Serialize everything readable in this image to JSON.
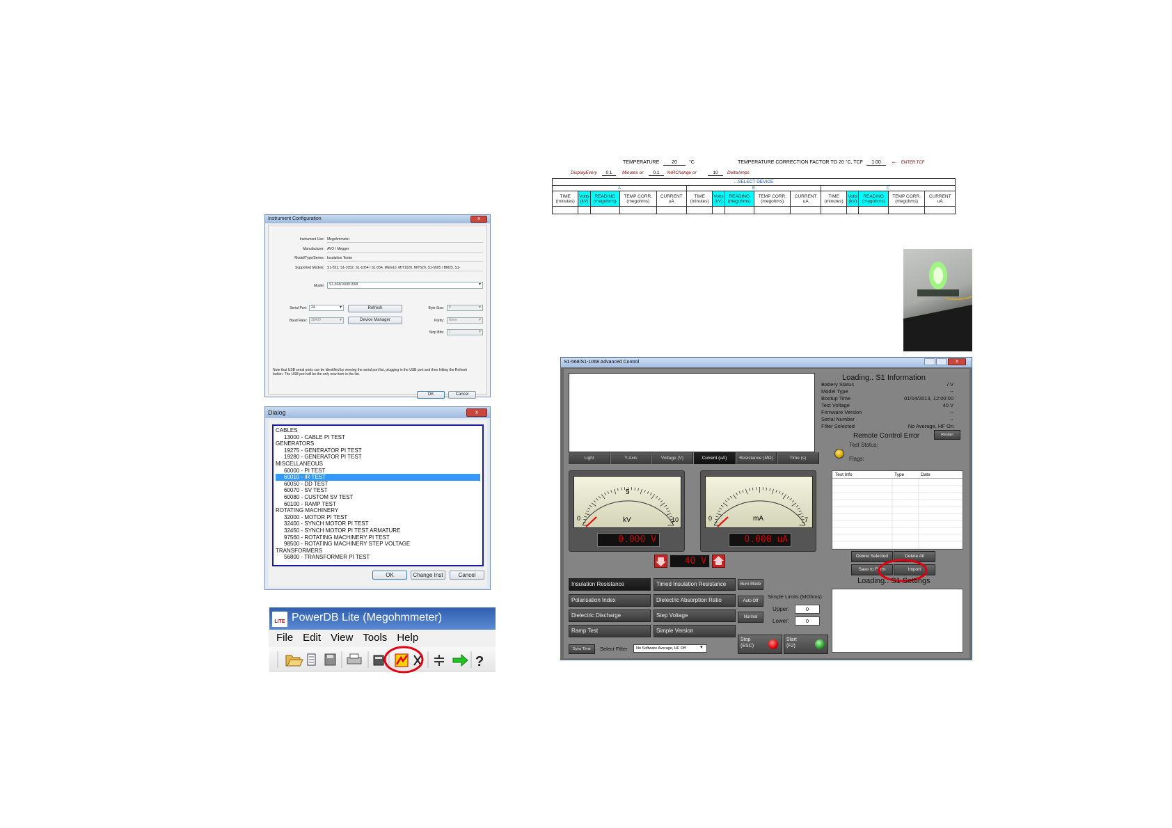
{
  "instrument_config": {
    "title": "Instrument Configuration",
    "close": "x",
    "fields": [
      {
        "label": "Instrument Use:",
        "value": "Megohmmeter"
      },
      {
        "label": "Manufacturer:",
        "value": "AVO / Megger"
      },
      {
        "label": "Model/Type/Series:",
        "value": "Insulation Tester"
      },
      {
        "label": "Supported Models:",
        "value": "S1-552, S1-1052, S1-1054 / S1-554, MEG10, MIT1020, MIT520, S1-5005 / BM25, S1-"
      }
    ],
    "model_label": "Model:",
    "model_value": "S1-568/1068/1568",
    "serial_port_label": "Serial Port:",
    "serial_port_value": "24",
    "baud_rate_label": "Baud Rate:",
    "baud_rate_value": "38400",
    "refresh": "Refresh",
    "device_manager": "Device Manager",
    "byte_size_label": "Byte Size:",
    "byte_size_value": "8",
    "parity_label": "Parity:",
    "parity_value": "None",
    "stop_bits_label": "Stop Bits:",
    "stop_bits_value": "1",
    "note": "Note that USB serial ports can be identified by viewing the serial port list, plugging in the USB port and then hitting the Refresh button. The USB port will be the only new item in the list.",
    "ok": "OK",
    "cancel": "Cancel"
  },
  "dialog": {
    "title": "Dialog",
    "close": "x",
    "items": [
      {
        "text": "CABLES",
        "indent": false
      },
      {
        "text": "13000 - CABLE PI TEST",
        "indent": true
      },
      {
        "text": "GENERATORS",
        "indent": false
      },
      {
        "text": "19275 - GENERATOR PI TEST",
        "indent": true
      },
      {
        "text": "19280 - GENERATOR PI TEST",
        "indent": true
      },
      {
        "text": "MISCELLANEOUS",
        "indent": false
      },
      {
        "text": "60000 - PI TEST",
        "indent": true
      },
      {
        "text": "60010 - IR TEST",
        "indent": true,
        "selected": true
      },
      {
        "text": "60050 - DD TEST",
        "indent": true
      },
      {
        "text": "60070 - SV TEST",
        "indent": true
      },
      {
        "text": "60080 - CUSTOM SV TEST",
        "indent": true
      },
      {
        "text": "60100 - RAMP TEST",
        "indent": true
      },
      {
        "text": "ROTATING MACHINERY",
        "indent": false
      },
      {
        "text": "32000 - MOTOR PI TEST",
        "indent": true
      },
      {
        "text": "32400 - SYNCH MOTOR PI TEST",
        "indent": true
      },
      {
        "text": "32450 - SYNCH MOTOR PI TEST ARMATURE",
        "indent": true
      },
      {
        "text": "97560 - ROTATING MACHINERY PI TEST",
        "indent": true
      },
      {
        "text": "98500 - ROTATING MACHINERY STEP VOLTAGE",
        "indent": true
      },
      {
        "text": "TRANSFORMERS",
        "indent": false
      },
      {
        "text": "56800 - TRANSFORMER PI TEST",
        "indent": true
      }
    ],
    "ok": "OK",
    "change_inst": "Change Inst",
    "cancel": "Cancel"
  },
  "powerdb": {
    "logo": "LITE",
    "title": "PowerDB Lite (Megohmmeter)",
    "menu": [
      "File",
      "Edit",
      "View",
      "Tools",
      "Help"
    ]
  },
  "form": {
    "temperature_label": "TEMPERATURE",
    "temperature_value": "20",
    "temperature_unit": "°C",
    "tcf_label": "TEMPERATURE CORRECTION FACTOR TO 20 °C, TCF",
    "tcf_value": "1.00",
    "enter_tcf": "ENTER TCF",
    "display_every_label": "DisplayEvery",
    "display_every_value": "0.1",
    "minutes_or": "Minutes or",
    "pct_value": "0.1",
    "pct_label": "%IRChange or",
    "delta_value": "10",
    "delta_label": "DeltaAmps",
    "select_device": "...SELECT DEVICE",
    "groups": [
      "A",
      "B",
      "C"
    ],
    "columns": [
      {
        "l1": "TIME",
        "l2": "(minutes)",
        "cyan": false
      },
      {
        "l1": "Volts",
        "l2": "(kV)",
        "cyan": true
      },
      {
        "l1": "READING",
        "l2": "(megohms)",
        "cyan": true
      },
      {
        "l1": "TEMP CORR.",
        "l2": "(megohms)",
        "cyan": false
      },
      {
        "l1": "CURRENT",
        "l2": "uA",
        "cyan": false
      }
    ]
  },
  "advanced": {
    "title": "S1-568/S1-1068 Advanced Control",
    "tabs": [
      "Light",
      "Y-Axis",
      "Voltage (V)",
      "Current (uA)",
      "Resistance (MΩ)",
      "Time (s)"
    ],
    "active_tab": 3,
    "info_title": "Loading.. S1 Information",
    "info": [
      {
        "label": "Battery Status",
        "value": "/ V"
      },
      {
        "label": "Model Type",
        "value": "--"
      },
      {
        "label": "Bootup Time",
        "value": "01/04/2013, 12:00:00"
      },
      {
        "label": "Test Voltage",
        "value": "40 V"
      },
      {
        "label": "Firmware Version",
        "value": "--"
      },
      {
        "label": "Serial Number",
        "value": "--"
      },
      {
        "label": "Filter Selected",
        "value": "No Average, HF On"
      }
    ],
    "remote_error": "Remote Control Error",
    "restart": "Restart",
    "test_status": "Test Status:",
    "flags": "Flags:",
    "test_table_headers": [
      "Test Info",
      "Type",
      "Date"
    ],
    "delete_selected": "Delete Selected",
    "delete_all": "Delete All",
    "save_to_form": "Save to Form",
    "import": "Import",
    "settings_title": "Loading.. S1 Settings",
    "meter1": {
      "mid": "5",
      "min": "0",
      "max": "10",
      "unit": "kV",
      "readout": "0.000 V"
    },
    "meter2": {
      "min": "0",
      "max": "7",
      "unit": "mA",
      "readout": "0.000 uA"
    },
    "voltage_readout": "40 V",
    "modes_left": [
      "Insulation Resistance",
      "Polarisation Index",
      "Dielectric Discharge",
      "Ramp Test"
    ],
    "modes_right": [
      "Timed Insulation Resistance",
      "Dielectric Absorption Ratio",
      "Step Voltage",
      "Simple Version"
    ],
    "side_buttons": [
      "Burn Mode",
      "Auto Off",
      "Normal"
    ],
    "limits_title": "Simple Limits (MOhms)",
    "upper_label": "Upper:",
    "upper_value": "0",
    "lower_label": "Lower:",
    "lower_value": "0",
    "sync_time": "Sync Time",
    "select_filter_label": "Select Filter",
    "select_filter_value": "No Software Average, HF Off",
    "stop_l1": "Stop",
    "stop_l2": "(ESC)",
    "start_l1": "Start",
    "start_l2": "(F2)"
  }
}
